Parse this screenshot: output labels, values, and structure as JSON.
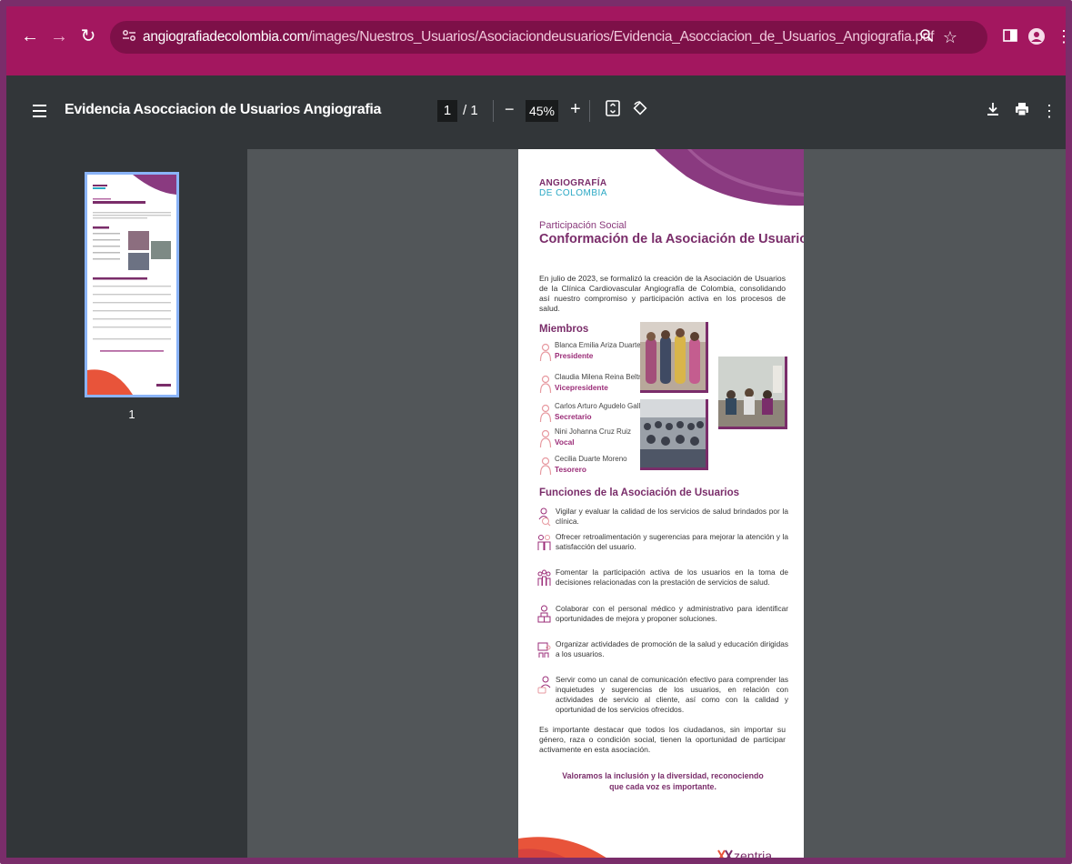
{
  "browser": {
    "url_host": "angiografiadecolombia.com",
    "url_path": "/images/Nuestros_Usuarios/Asociaciondeusuarios/Evidencia_Asocciacion_de_Usuarios_Angiografia.pdf"
  },
  "toolbar": {
    "title": "Evidencia Asocciacion de Usuarios Angiografia",
    "page_current": "1",
    "page_total": "/ 1",
    "zoom": "45%",
    "zoom_out": "−",
    "zoom_in": "+"
  },
  "sidebar": {
    "thumbnail_label": "1"
  },
  "document": {
    "logo_line1": "ANGIOGRAFÍA",
    "logo_line2": "DE COLOMBIA",
    "kicker": "Participación Social",
    "title": "Conformación de la Asociación de Usuarios",
    "intro": "En julio de 2023, se formalizó la creación de la Asociación de Usuarios de la Clínica Cardiovascular Angiografía de Colombia, consolidando así nuestro compromiso y participación activa en los procesos de salud.",
    "members_heading": "Miembros",
    "members": [
      {
        "name": "Blanca Emilia Ariza Duarte",
        "role": "Presidente"
      },
      {
        "name": "Claudia Milena Reina Beltrán",
        "role": "Vicepresidente"
      },
      {
        "name": "Carlos Arturo Agudelo Gallego",
        "role": "Secretario"
      },
      {
        "name": "Nini Johanna Cruz Ruiz",
        "role": "Vocal"
      },
      {
        "name": "Cecilia Duarte Moreno",
        "role": "Tesorero"
      }
    ],
    "functions_heading": "Funciones de la Asociación de Usuarios",
    "functions": [
      "Vigilar y evaluar la calidad de los servicios de salud brindados por la clínica.",
      "Ofrecer retroalimentación y sugerencias para mejorar la atención y la satisfacción del usuario.",
      "Fomentar la participación activa de los usuarios en la toma de decisiones relacionadas con la prestación de servicios de salud.",
      "Colaborar con el personal médico y administrativo para identificar oportunidades de mejora y proponer soluciones.",
      "Organizar actividades de promoción de la salud y educación dirigidas a los usuarios.",
      "Servir como un canal de comunicación efectivo para comprender las inquietudes y sugerencias de los usuarios, en relación con actividades de servicio al cliente, así como con la calidad y oportunidad de los servicios ofrecidos."
    ],
    "closing": "Es importante destacar que todos los ciudadanos, sin importar su género, raza o condición social, tienen la oportunidad de participar activamente en esta asociación.",
    "slogan": "Valoramos la inclusión y la diversidad, reconociendo que cada voz es importante.",
    "brand": "zentria"
  },
  "colors": {
    "browser_bar": "#a3175f",
    "pdf_toolbar": "#323639",
    "viewer_bg": "#525659",
    "brand_purple": "#7a2d6a",
    "accent_orange": "#e8543a"
  }
}
